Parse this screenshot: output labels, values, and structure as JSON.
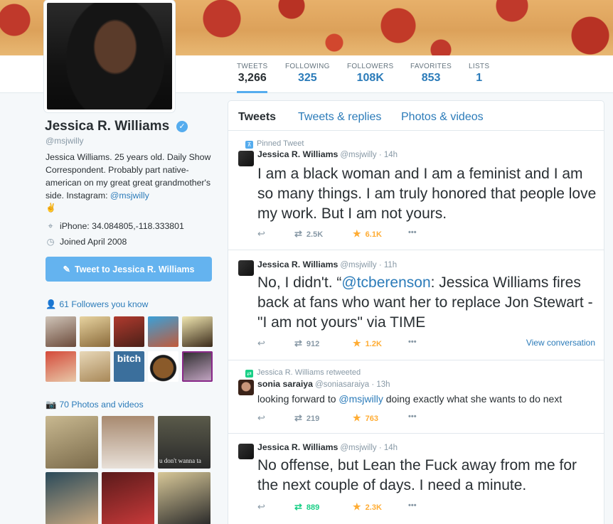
{
  "profile": {
    "name": "Jessica R. Williams",
    "handle": "@msjwilly",
    "bio_text": "Jessica Williams. 25 years old. Daily Show Correspondent. Probably part native-american on my great great grandmother's side. Instagram: ",
    "bio_link": "@msjwilly",
    "bio_emoji": "✌",
    "location": "iPhone: 34.084805,-118.333801",
    "joined": "Joined April 2008",
    "tweet_to_label": "Tweet to Jessica R. Williams",
    "followers_you_know": "61 Followers you know",
    "photos_videos": "70 Photos and videos"
  },
  "stats": [
    {
      "label": "Tweets",
      "value": "3,266"
    },
    {
      "label": "Following",
      "value": "325"
    },
    {
      "label": "Followers",
      "value": "108K"
    },
    {
      "label": "Favorites",
      "value": "853"
    },
    {
      "label": "Lists",
      "value": "1"
    }
  ],
  "tabs": [
    "Tweets",
    "Tweets & replies",
    "Photos & videos"
  ],
  "tweets": [
    {
      "context": "Pinned Tweet",
      "name": "Jessica R. Williams",
      "handle": "@msjwilly · 14h",
      "text": "I am a black woman and I am a feminist and I am so many things. I am truly honored that people love my work. But I am not yours.",
      "retweets": "2.5K",
      "favorites": "6.1K"
    },
    {
      "name": "Jessica R. Williams",
      "handle": "@msjwilly · 11h",
      "text_pre": "No, I didn't. “",
      "mention": "@tcberenson",
      "text_post": ": Jessica Williams fires back at fans who want her to replace Jon Stewart - \"I am not yours\" via TIME",
      "retweets": "912",
      "favorites": "1.2K",
      "view_conversation": "View conversation"
    },
    {
      "context": "Jessica R. Williams retweeted",
      "name": "sonia saraiya",
      "handle": "@soniasaraiya · 13h",
      "text_pre": "looking forward to ",
      "mention": "@msjwilly",
      "text_post": " doing exactly what she wants to do next",
      "retweets": "219",
      "favorites": "763"
    },
    {
      "name": "Jessica R. Williams",
      "handle": "@msjwilly · 14h",
      "text": "No offense, but Lean the Fuck away from me for the next couple of days. I need a minute.",
      "retweets": "889",
      "favorites": "2.3K"
    }
  ],
  "photo_captions": {
    "p3": "u don't wanna ta",
    "follower_7": "bitch"
  },
  "colors": {
    "accent": "#55acee",
    "link": "#2b7bb9",
    "favorite": "#ffac33",
    "retweet": "#19cf86"
  },
  "icons": [
    "verified-badge-icon",
    "location-pin-icon",
    "calendar-icon",
    "compose-icon",
    "person-icon",
    "camera-icon",
    "reply-icon",
    "retweet-icon",
    "star-icon",
    "more-icon",
    "pin-icon"
  ]
}
